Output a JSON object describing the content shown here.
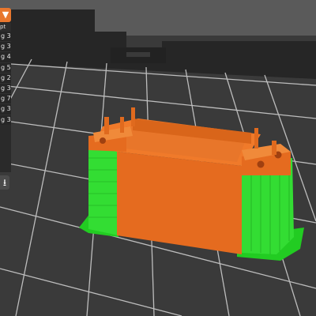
{
  "sidebar": {
    "dropdown_glyph": "▼",
    "header_text": "pt",
    "rows": [
      "3 g",
      "3 g",
      "4 g",
      "5 g",
      "2 g",
      "3 g",
      "7 g",
      "3 g",
      "3 g",
      "1 g"
    ],
    "download_glyph": "⭳"
  },
  "colors": {
    "bed": "#3b3b3b",
    "grid_line": "#d9d9d9",
    "model_wall": "#e56b1f",
    "support": "#2fd52f",
    "accent": "#e8772e"
  },
  "icons": [
    "chevron-down-icon",
    "download-icon"
  ]
}
